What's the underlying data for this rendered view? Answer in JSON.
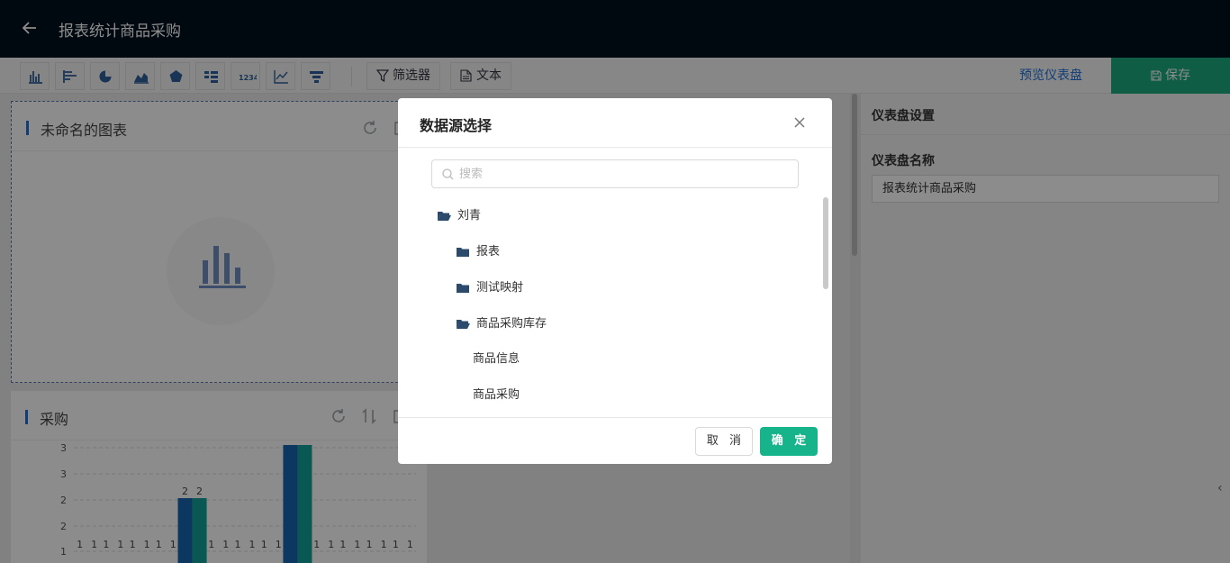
{
  "header": {
    "title": "报表统计商品采购"
  },
  "toolbar": {
    "chart_buttons": [
      "bar-chart-icon",
      "horizontal-bar-icon",
      "pie-chart-icon",
      "area-chart-icon",
      "radar-chart-icon",
      "table-icon",
      "number-icon",
      "line-chart-icon",
      "funnel-icon"
    ],
    "filter_label": "筛选器",
    "text_label": "文本",
    "preview_label": "预览仪表盘",
    "save_label": "保存"
  },
  "cards": [
    {
      "title": "未命名的图表"
    },
    {
      "title": "采购"
    }
  ],
  "chart_data": {
    "type": "bar",
    "title": "采购",
    "yticks": [
      "1",
      "2",
      "2",
      "3",
      "3"
    ],
    "series": [
      {
        "values": [
          1,
          1,
          1,
          1,
          2,
          1,
          1,
          1,
          3,
          1,
          1,
          1,
          1
        ]
      },
      {
        "values": [
          1,
          1,
          1,
          1,
          2,
          1,
          1,
          1,
          3,
          1,
          1,
          1,
          1
        ]
      }
    ],
    "colors": [
      "#1664b0",
      "#11a09a"
    ],
    "ylim": [
      1,
      3
    ]
  },
  "right_panel": {
    "title": "仪表盘设置",
    "name_label": "仪表盘名称",
    "name_value": "报表统计商品采购"
  },
  "modal": {
    "title": "数据源选择",
    "search_placeholder": "搜索",
    "tree": {
      "root": "刘青",
      "folders": [
        "报表",
        "测试映射",
        "商品采购库存"
      ],
      "leaves": [
        "商品信息",
        "商品采购"
      ]
    },
    "cancel_label": "取 消",
    "ok_label": "确 定"
  }
}
